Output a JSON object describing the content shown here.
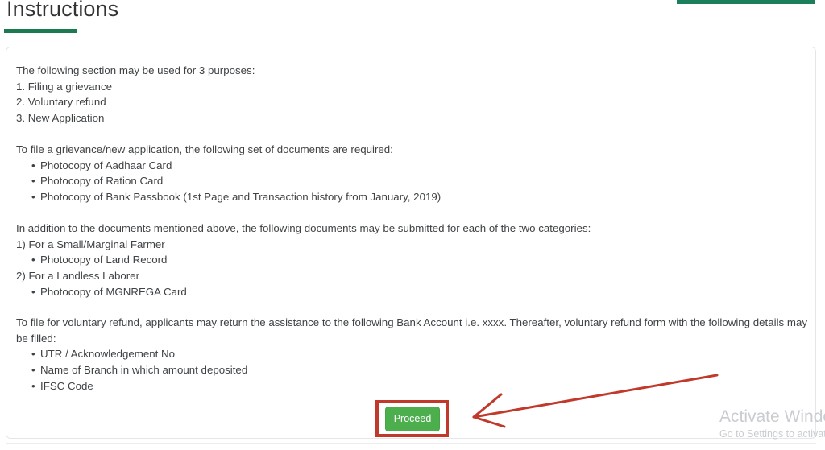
{
  "page": {
    "title": "Instructions",
    "accent_green": "#1b7a4f",
    "top_bar_color": "#1a7f5a"
  },
  "instructions": {
    "purposes": {
      "intro": "The following section may be used for 3 purposes:",
      "items": [
        "1. Filing a grievance",
        "2. Voluntary refund",
        "3. New Application"
      ]
    },
    "documents": {
      "intro": "To file a grievance/new application, the following set of documents are required:",
      "items": [
        "Photocopy of Aadhaar Card",
        "Photocopy of Ration Card",
        "Photocopy of Bank Passbook (1st Page and Transaction history from January, 2019)"
      ]
    },
    "categories": {
      "intro": "In addition to the documents mentioned above, the following documents may be submitted for each of the two categories:",
      "category_one_label": "1) For a Small/Marginal Farmer",
      "category_one_item": "Photocopy of Land Record",
      "category_two_label": "2) For a Landless Laborer",
      "category_two_item": "Photocopy of MGNREGA Card"
    },
    "refund": {
      "intro_line_1": "To file for voluntary refund, applicants may return the assistance to the following Bank Account i.e. xxxx. Thereafter, voluntary refund form with the following details may",
      "intro_line_2": "be filled:",
      "items": [
        "UTR / Acknowledgement No",
        "Name of Branch in which amount deposited",
        "IFSC Code"
      ]
    }
  },
  "actions": {
    "proceed_label": "Proceed",
    "proceed_color": "#4cae4c",
    "highlight_color": "#c0392b",
    "arrow_color": "#c0392b"
  },
  "watermark": {
    "title": "Activate Windows",
    "subtitle": "Go to Settings to activate Windows."
  }
}
